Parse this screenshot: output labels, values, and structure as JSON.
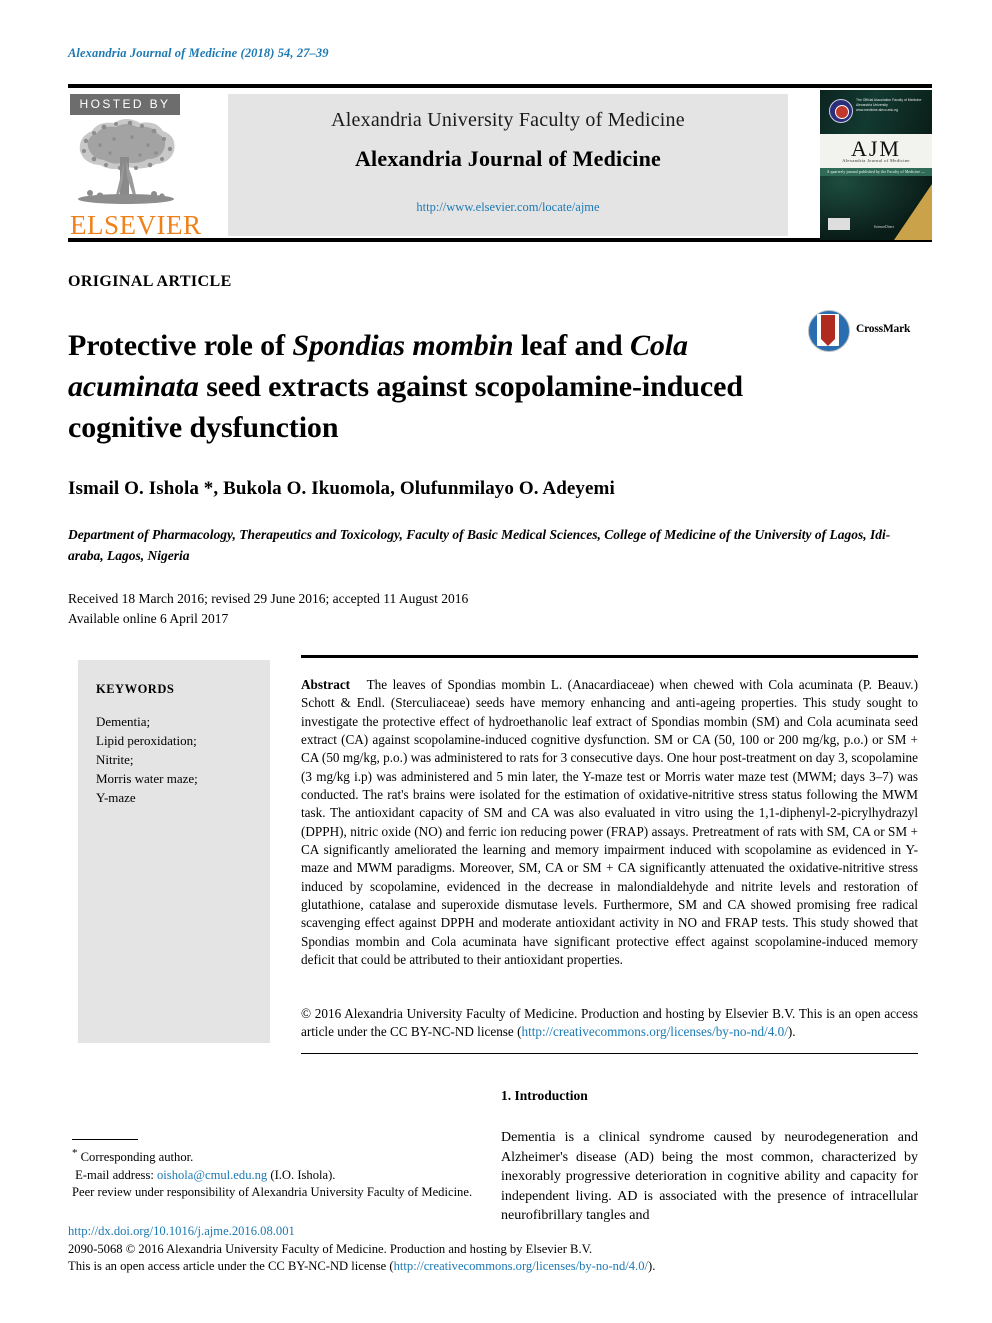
{
  "running_head": {
    "journal": "Alexandria Journal of Medicine (2018) 54, 27–39"
  },
  "header": {
    "hosted_by": "HOSTED BY",
    "publisher": "ELSEVIER",
    "faculty_line": "Alexandria University Faculty of Medicine",
    "journal_title": "Alexandria Journal of Medicine",
    "journal_url": "http://www.elsevier.com/locate/ajme",
    "cover": {
      "acronym": "AJM",
      "acronym_sub": "Alexandria Journal of Medicine",
      "seal_text": "The Official Association Faculty of Medicine Alexandria University www.medicine.alexu.edu.eg",
      "band_text": "A quarterly journal published by the Faculty of Medicine — Alexandria University",
      "foot_text": "ScienceDirect"
    }
  },
  "article": {
    "kicker": "ORIGINAL ARTICLE",
    "title_parts": [
      {
        "text": "Protective role of ",
        "italic": false
      },
      {
        "text": "Spondias mombin",
        "italic": true
      },
      {
        "text": " leaf and ",
        "italic": false
      },
      {
        "text": "Cola acuminata",
        "italic": true
      },
      {
        "text": " seed extracts against scopolamine-induced cognitive dysfunction",
        "italic": false
      }
    ],
    "title_plain": "Protective role of Spondias mombin leaf and Cola acuminata seed extracts against scopolamine-induced cognitive dysfunction",
    "crossmark_label": "CrossMark",
    "authors": "Ismail O. Ishola *, Bukola O. Ikuomola, Olufunmilayo O. Adeyemi",
    "corresponding_marker": "*",
    "affiliation": "Department of Pharmacology, Therapeutics and Toxicology, Faculty of Basic Medical Sciences, College of Medicine of the University of Lagos, Idi-araba, Lagos, Nigeria",
    "received_line": "Received 18 March 2016; revised 29 June 2016; accepted 11 August 2016",
    "available_line": "Available online 6 April 2017"
  },
  "keywords": {
    "heading": "KEYWORDS",
    "items": [
      "Dementia;",
      "Lipid peroxidation;",
      "Nitrite;",
      "Morris water maze;",
      "Y-maze"
    ]
  },
  "abstract": {
    "label": "Abstract",
    "text": "The leaves of Spondias mombin L. (Anacardiaceae) when chewed with Cola acuminata (P. Beauv.) Schott & Endl. (Sterculiaceae) seeds have memory enhancing and anti-ageing properties. This study sought to investigate the protective effect of hydroethanolic leaf extract of Spondias mombin (SM) and Cola acuminata seed extract (CA) against scopolamine-induced cognitive dysfunction. SM or CA (50, 100 or 200 mg/kg, p.o.) or SM + CA (50 mg/kg, p.o.) was administered to rats for 3 consecutive days. One hour post-treatment on day 3, scopolamine (3 mg/kg i.p) was administered and 5 min later, the Y-maze test or Morris water maze test (MWM; days 3–7) was conducted. The rat's brains were isolated for the estimation of oxidative-nitritive stress status following the MWM task. The antioxidant capacity of SM and CA was also evaluated in vitro using the 1,1-diphenyl-2-picrylhydrazyl (DPPH), nitric oxide (NO) and ferric ion reducing power (FRAP) assays. Pretreatment of rats with SM, CA or SM + CA significantly ameliorated the learning and memory impairment induced with scopolamine as evidenced in Y-maze and MWM paradigms. Moreover, SM, CA or SM + CA significantly attenuated the oxidative-nitritive stress induced by scopolamine, evidenced in the decrease in malondialdehyde and nitrite levels and restoration of glutathione, catalase and superoxide dismutase levels. Furthermore, SM and CA showed promising free radical scavenging effect against DPPH and moderate antioxidant activity in NO and FRAP tests. This study showed that Spondias mombin and Cola acuminata have significant protective effect against scopolamine-induced memory deficit that could be attributed to their antioxidant properties.",
    "copyright_prefix": "© 2016 Alexandria University Faculty of Medicine. Production and hosting by Elsevier B.V. This is an open access article under the CC BY-NC-ND license (",
    "copyright_link": "http://creativecommons.org/licenses/by-no-nd/4.0/",
    "copyright_suffix": ")."
  },
  "introduction": {
    "heading": "1. Introduction",
    "body": "Dementia is a clinical syndrome caused by neurodegeneration and Alzheimer's disease (AD) being the most common, characterized by inexorably progressive deterioration in cognitive ability and capacity for independent living. AD is associated with the presence of intracellular neurofibrillary tangles and"
  },
  "footnotes": {
    "corresponding_author": "Corresponding author.",
    "email_label": "E-mail address:",
    "email": "oishola@cmul.edu.ng",
    "email_suffix": "(I.O. Ishola).",
    "peer_review": "Peer review under responsibility of Alexandria University Faculty of Medicine."
  },
  "footer": {
    "doi": "http://dx.doi.org/10.1016/j.ajme.2016.08.001",
    "issn_line": "2090-5068 © 2016 Alexandria University Faculty of Medicine. Production and hosting by Elsevier B.V.",
    "license_prefix": "This is an open access article under the CC BY-NC-ND license (",
    "license_link": "http://creativecommons.org/licenses/by-no-nd/4.0/",
    "license_suffix": ")."
  },
  "colors": {
    "link": "#1c79b3",
    "elsevier_orange": "#f08019",
    "panel_grey": "#e4e4e4",
    "hosted_grey": "#6d6d6d",
    "crossmark_blue": "#2a6db0",
    "crossmark_red": "#b02a20"
  }
}
